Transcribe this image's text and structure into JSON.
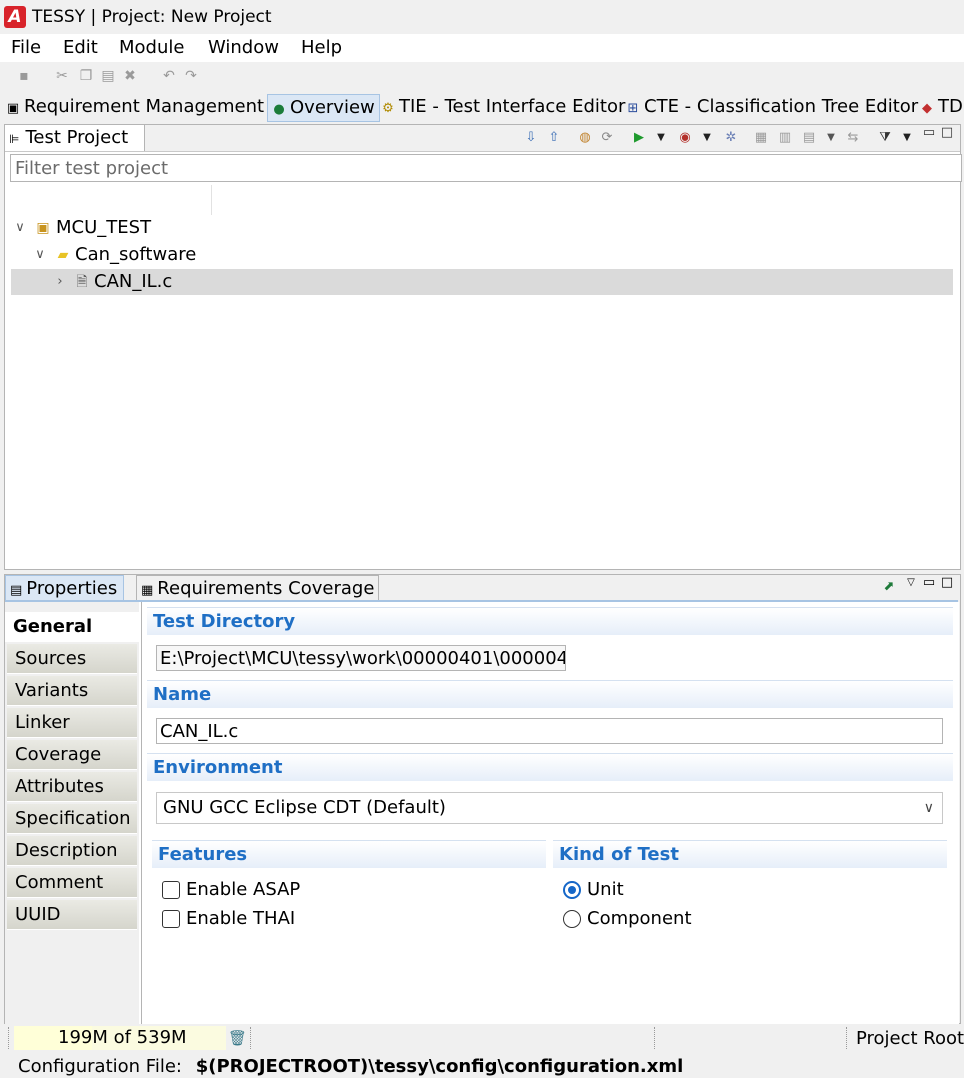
{
  "window": {
    "title": "TESSY | Project: New Project",
    "logo_letter": "A"
  },
  "menu": [
    "File",
    "Edit",
    "Module",
    "Window",
    "Help"
  ],
  "toolbar_icons": [
    "save-icon",
    "cut-icon",
    "copy-icon",
    "paste-icon",
    "delete-icon",
    "undo-icon",
    "redo-icon"
  ],
  "perspectives": [
    {
      "label": "Requirement Management",
      "icon": "requirement-icon"
    },
    {
      "label": "Overview",
      "icon": "globe-icon",
      "active": true
    },
    {
      "label": "TIE - Test Interface Editor",
      "icon": "tie-icon"
    },
    {
      "label": "CTE - Classification Tree Editor",
      "icon": "cte-icon"
    },
    {
      "label": "TD",
      "icon": "td-icon"
    }
  ],
  "test_project": {
    "tab_label": "Test Project",
    "filter_placeholder": "Filter test project",
    "tree": [
      {
        "label": "MCU_TEST",
        "icon": "project-icon",
        "expanded": true
      },
      {
        "label": "Can_software",
        "icon": "folder-icon",
        "expanded": true
      },
      {
        "label": "CAN_IL.c",
        "icon": "c-file-icon",
        "selected": true
      }
    ]
  },
  "properties": {
    "tabs": [
      "Properties",
      "Requirements Coverage"
    ],
    "side_tabs": [
      "General",
      "Sources",
      "Variants",
      "Linker",
      "Coverage",
      "Attributes",
      "Specification",
      "Description",
      "Comment",
      "UUID"
    ],
    "active_side_tab": "General",
    "test_directory": {
      "title": "Test Directory",
      "value": "E:\\Project\\MCU\\tessy\\work\\00000401\\000004("
    },
    "name": {
      "title": "Name",
      "value": "CAN_IL.c"
    },
    "environment": {
      "title": "Environment",
      "value": "GNU GCC Eclipse CDT (Default)"
    },
    "features": {
      "title": "Features",
      "enable_asap": "Enable ASAP",
      "enable_thai": "Enable THAI",
      "asap_checked": false,
      "thai_checked": false
    },
    "kind_of_test": {
      "title": "Kind of Test",
      "unit": "Unit",
      "component": "Component",
      "selected": "Unit"
    }
  },
  "status": {
    "heap": "199M of 539M",
    "heap_fraction": 0.37,
    "project_root": "Project Root:",
    "config_label": "Configuration File:",
    "config_value": "$(PROJECTROOT)\\tessy\\config\\configuration.xml"
  }
}
